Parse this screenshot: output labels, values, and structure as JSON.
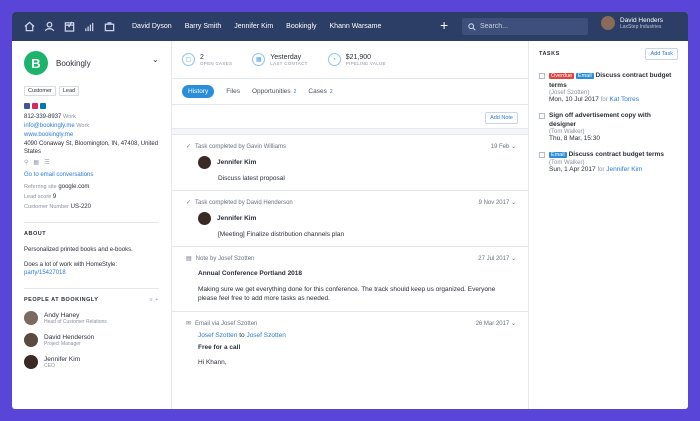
{
  "nav": {
    "icons": [
      "home-icon",
      "person-icon",
      "calendar-icon",
      "chart-icon",
      "briefcase-icon"
    ],
    "links": [
      "David Dyson",
      "Barry Smith",
      "Jennifer Kim",
      "Bookingly",
      "Khann Warsame"
    ],
    "plus": "+",
    "search_placeholder": "Search...",
    "user_name": "David Henders",
    "user_company": "LaxStep Industries"
  },
  "company": {
    "letter": "B",
    "name": "Bookingly",
    "tags": [
      "Customer",
      "Lead"
    ],
    "social_colors": [
      "#3b5998",
      "#e0245e",
      "#0077b5"
    ],
    "phone": "812-339-8937",
    "phone_type": "Work",
    "email": "info@bookingly.me",
    "email_type": "Work",
    "website": "www.bookingly.me",
    "address": "4090 Conaway St, Bloomington, IN, 47408, United States",
    "email_conv": "Go to email conversations",
    "referring_label": "Referring site",
    "referring_value": "google.com",
    "lead_label": "Lead score",
    "lead_value": "9",
    "customer_label": "Customer Number",
    "customer_value": "US-220"
  },
  "about": {
    "heading": "ABOUT",
    "text": "Personalized printed books and e-books.",
    "homestyle_prefix": "Does a lot of work with HomeStyle:",
    "homestyle_link": "party/15427018"
  },
  "people": {
    "heading": "PEOPLE AT BOOKINGLY",
    "items": [
      {
        "name": "Andy Haney",
        "role": "Head of Customer Relations",
        "color": "#7a6a60"
      },
      {
        "name": "David Henderson",
        "role": "Project Manager",
        "color": "#5a4a40"
      },
      {
        "name": "Jennifer Kim",
        "role": "CEO",
        "color": "#3a2a26"
      }
    ]
  },
  "stats": [
    {
      "value": "2",
      "label": "OPEN CASES",
      "icon": "case-icon"
    },
    {
      "value": "Yesterday",
      "label": "LAST CONTACT",
      "icon": "calendar-icon"
    },
    {
      "value": "$21,900",
      "label": "PIPELINE VALUE",
      "icon": "gauge-icon"
    }
  ],
  "tabs": [
    {
      "label": "History",
      "count": ""
    },
    {
      "label": "Files",
      "count": ""
    },
    {
      "label": "Opportunities",
      "count": "2"
    },
    {
      "label": "Cases",
      "count": "2"
    }
  ],
  "add_note": "Add Note",
  "history": [
    {
      "type": "task",
      "head": "Task completed by Gavin Williams",
      "date": "19 Feb",
      "who": "Jennifer Kim",
      "text": "Discuss latest proposal"
    },
    {
      "type": "task",
      "head": "Task completed by David Henderson",
      "date": "9 Nov 2017",
      "who": "Jennifer Kim",
      "text": "[Meeting] Finalize distribution channels plan"
    },
    {
      "type": "note",
      "head": "Note by Josef Szotten",
      "date": "27 Jul 2017",
      "title": "Annual Conference Portland 2018",
      "body": "Making sure we get everything done for this conference. The track should keep us organized. Everyone please feel free to add more tasks as needed."
    },
    {
      "type": "email",
      "head": "Email via Josef Szotten",
      "date": "26 Mar 2017",
      "from": "Josef Szotten",
      "to_word": "to",
      "to": "Josef Szotten",
      "subject": "Free for a call",
      "greeting": "Hi Khann,"
    }
  ],
  "tasks": {
    "heading": "TASKS",
    "add": "Add Task",
    "items": [
      {
        "pills": [
          "Overdue",
          "Email"
        ],
        "title": "Discuss contract budget terms",
        "who": "(Josef Szotten)",
        "date": "Mon, 10 Jul 2017",
        "for": "for",
        "for_who": "Kat Torres"
      },
      {
        "pills": [],
        "title": "Sign off advertisement copy with designer",
        "who": "(Tom Walker)",
        "date": "Thu, 8 Mar, 15:30",
        "for": "",
        "for_who": ""
      },
      {
        "pills": [
          "Email"
        ],
        "title": "Discuss contract budget terms",
        "who": "(Tom Walker)",
        "date": "Sun, 1 Apr 2017",
        "for": "for",
        "for_who": "Jennifer Kim"
      }
    ]
  }
}
